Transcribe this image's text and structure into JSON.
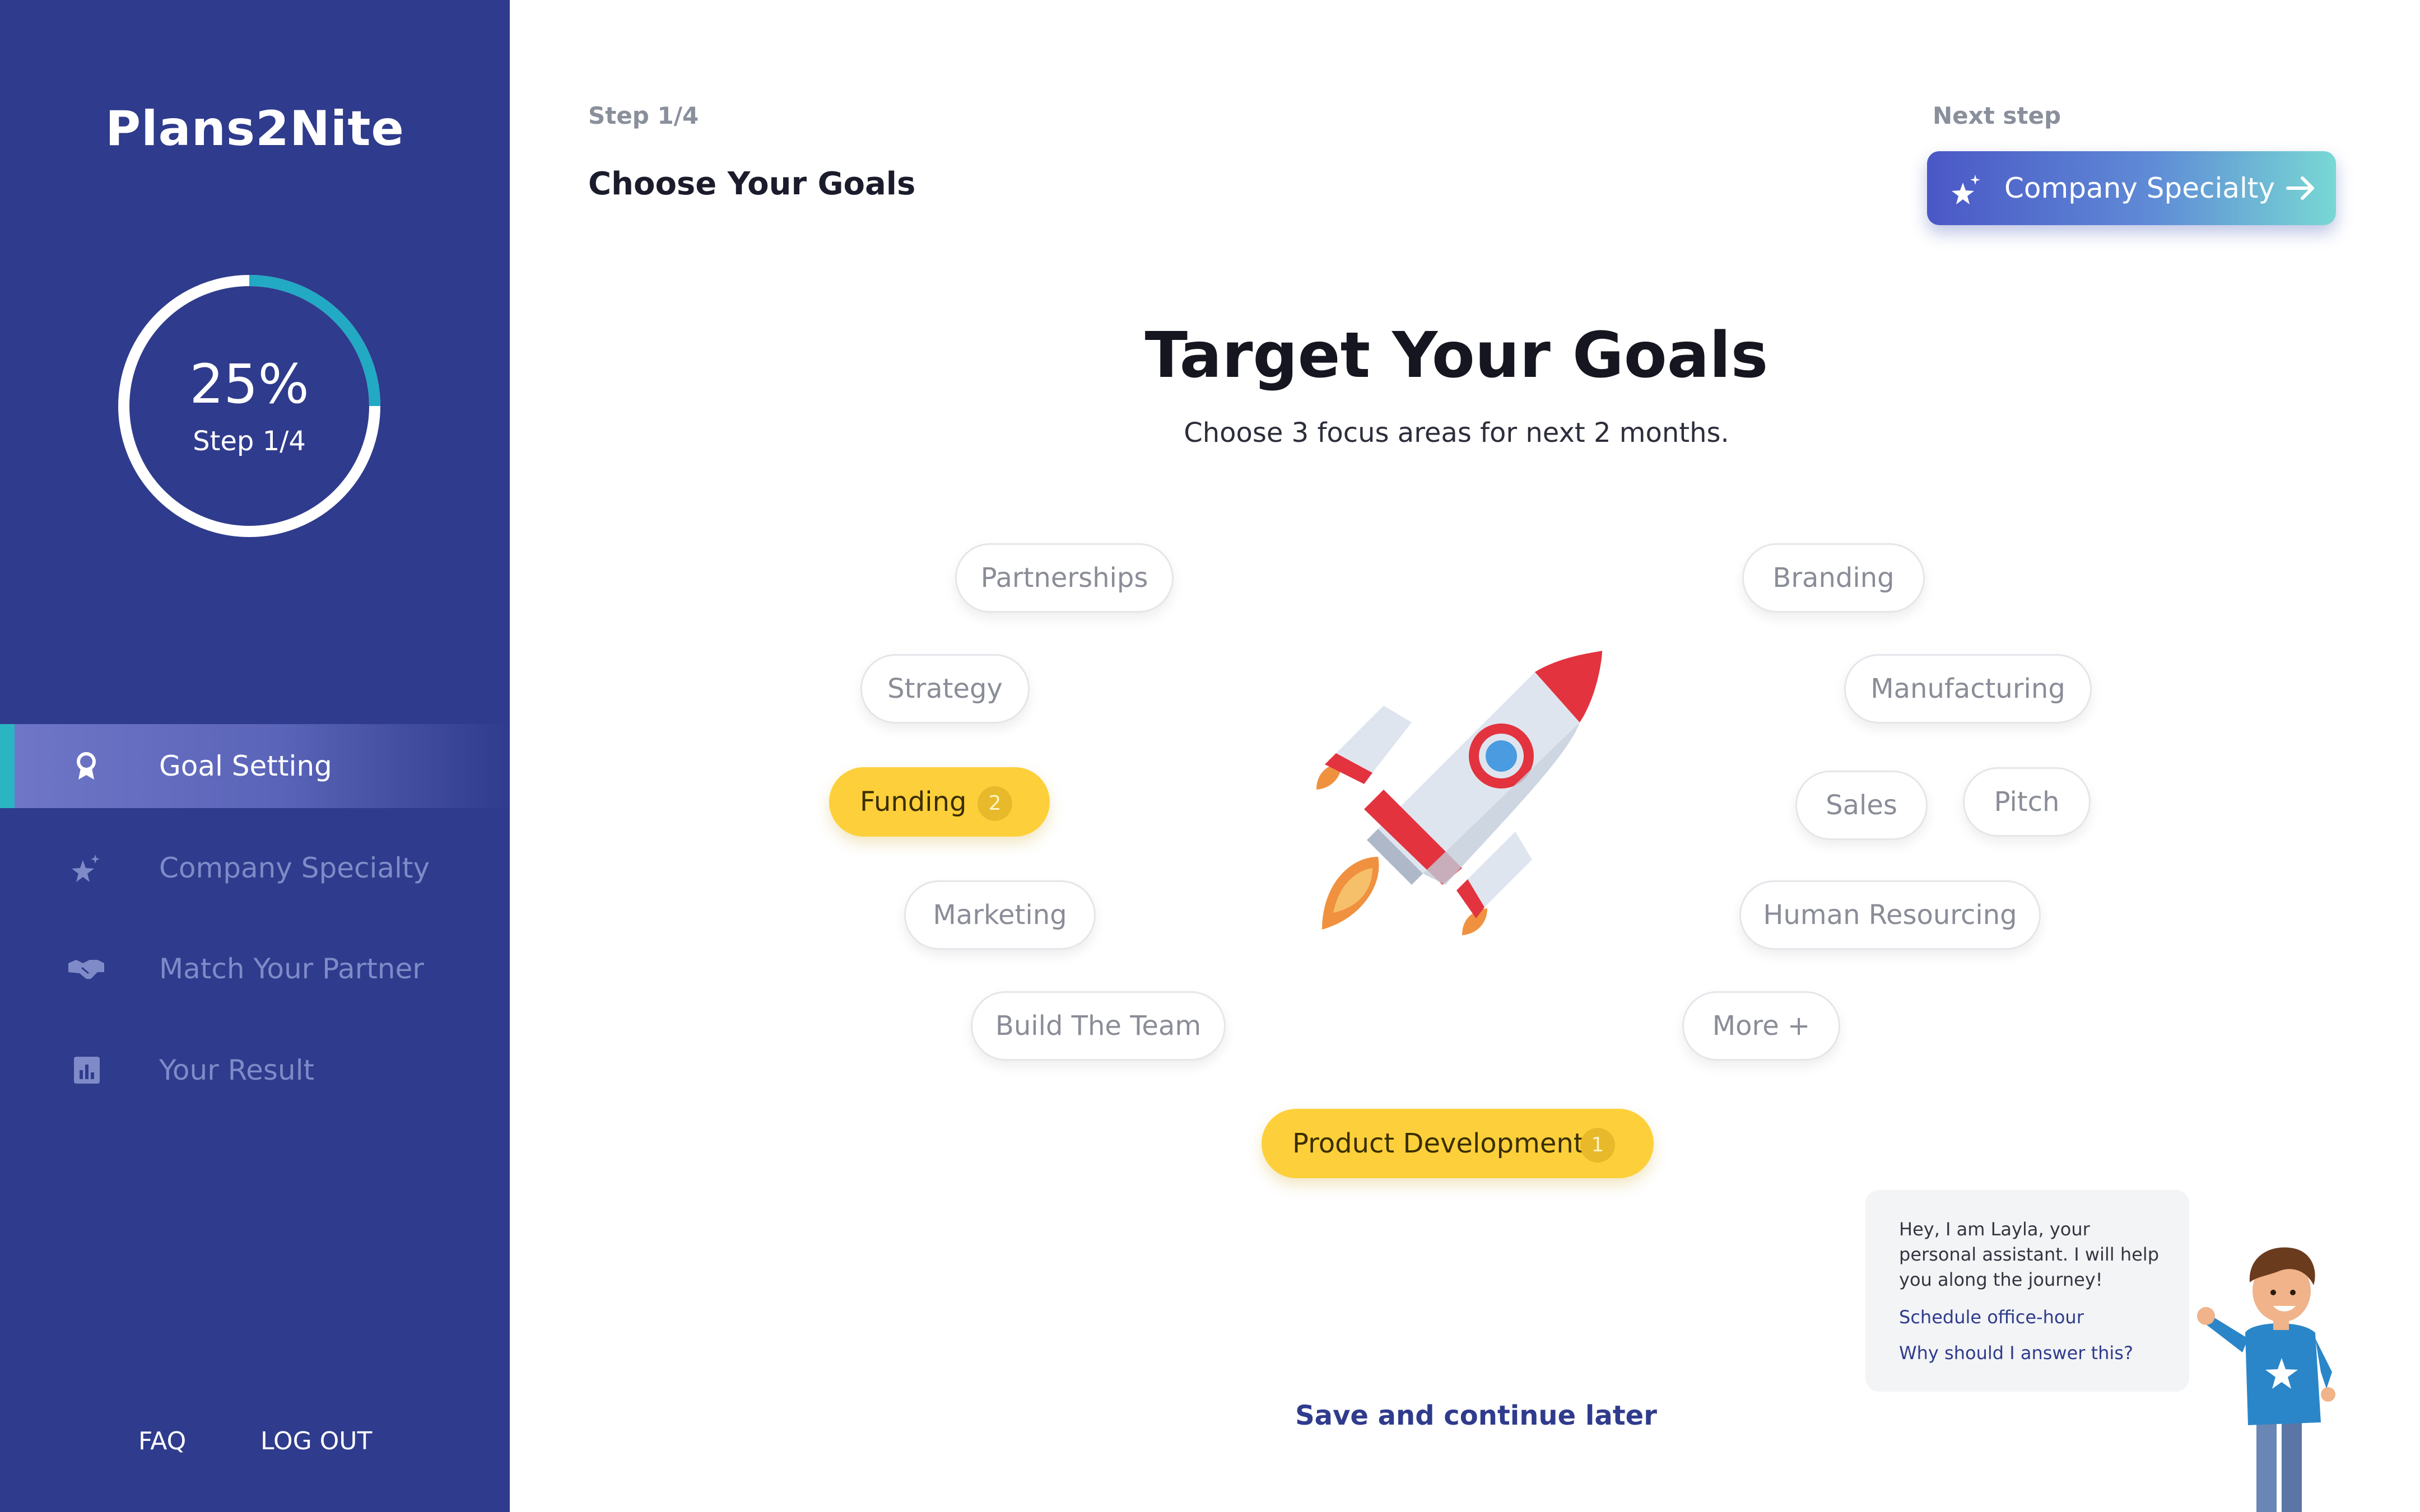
{
  "sidebar": {
    "brand": "Plans2Nite",
    "progress": {
      "percent_label": "25%",
      "step_label": "Step 1/4",
      "fraction": 0.25
    },
    "items": [
      {
        "label": "Goal Setting",
        "icon": "award-icon",
        "active": true
      },
      {
        "label": "Company Specialty",
        "icon": "sparkle-star-icon",
        "active": false
      },
      {
        "label": "Match Your Partner",
        "icon": "handshake-icon",
        "active": false
      },
      {
        "label": "Your Result",
        "icon": "bar-chart-icon",
        "active": false
      }
    ],
    "footer": {
      "faq": "FAQ",
      "logout": "LOG OUT"
    }
  },
  "header": {
    "step_label": "Step 1/4",
    "step_title": "Choose Your Goals",
    "next_label": "Next step",
    "next_button": "Company Specialty"
  },
  "main": {
    "title": "Target Your Goals",
    "subtitle": "Choose 3 focus areas for next 2 months.",
    "chips": [
      {
        "label": "Partnerships",
        "selected": false
      },
      {
        "label": "Strategy",
        "selected": false
      },
      {
        "label": "Funding",
        "selected": true,
        "badge": "2"
      },
      {
        "label": "Marketing",
        "selected": false
      },
      {
        "label": "Build The Team",
        "selected": false
      },
      {
        "label": "Product Development",
        "selected": true,
        "badge": "1"
      },
      {
        "label": "Branding",
        "selected": false
      },
      {
        "label": "Manufacturing",
        "selected": false
      },
      {
        "label": "Sales",
        "selected": false
      },
      {
        "label": "Pitch",
        "selected": false
      },
      {
        "label": "Human Resourcing",
        "selected": false
      },
      {
        "label": "More +",
        "selected": false
      }
    ],
    "save_later": "Save and continue later"
  },
  "assistant": {
    "message": "Hey, I am Layla, your personal assistant. I will help you along the journey!",
    "link1": "Schedule office-hour",
    "link2": "Why should I answer this?"
  },
  "colors": {
    "sidebar_bg": "#2f3b8c",
    "accent_teal": "#2bb5c2",
    "selected_chip": "#fdd03b",
    "link": "#2f3b8c"
  }
}
